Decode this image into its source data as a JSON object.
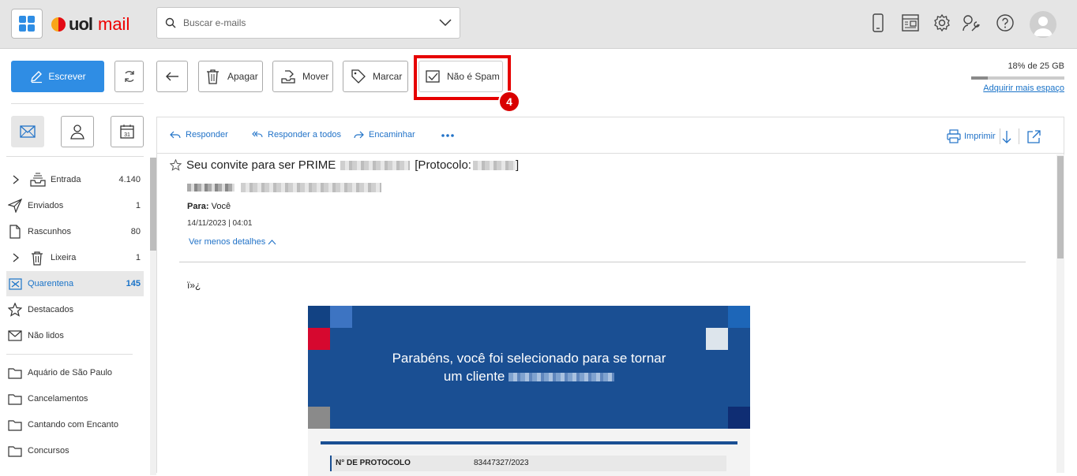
{
  "header": {
    "logo_brand": "uol",
    "logo_product": "mail",
    "search_placeholder": "Buscar e-mails",
    "icons": [
      "mobile-icon",
      "news-icon",
      "settings-icon",
      "tools-icon",
      "help-icon",
      "avatar"
    ]
  },
  "toolbar": {
    "compose_label": "Escrever",
    "delete_label": "Apagar",
    "move_label": "Mover",
    "tag_label": "Marcar",
    "not_spam_label": "Não é Spam",
    "step_badge": "4"
  },
  "quota": {
    "text": "18% de 25 GB",
    "percent": 18,
    "link": "Adquirir mais espaço"
  },
  "sidebar": {
    "folders": [
      {
        "label": "Entrada",
        "count": "4.140"
      },
      {
        "label": "Enviados",
        "count": "1"
      },
      {
        "label": "Rascunhos",
        "count": "80"
      },
      {
        "label": "Lixeira",
        "count": "1"
      },
      {
        "label": "Quarentena",
        "count": "145"
      },
      {
        "label": "Destacados",
        "count": ""
      },
      {
        "label": "Não lidos",
        "count": ""
      }
    ],
    "custom_folders": [
      {
        "label": "Aquário de São Paulo"
      },
      {
        "label": "Cancelamentos"
      },
      {
        "label": "Cantando com Encanto"
      },
      {
        "label": "Concursos"
      }
    ]
  },
  "message": {
    "actions": {
      "reply": "Responder",
      "reply_all": "Responder a todos",
      "forward": "Encaminhar",
      "print": "Imprimir"
    },
    "subject_prefix": "Seu convite para ser PRIME",
    "subject_protocol": "[Protocolo:",
    "subject_end": "]",
    "to_label": "Para:",
    "to_value": "Você",
    "date": "14/11/2023 | 04:01",
    "less_details": "Ver menos detalhes",
    "bom_text": "ï»¿",
    "banner_line1": "Parabéns, você foi selecionado para se tornar",
    "banner_line2": "um cliente",
    "protocol_label": "N° DE PROTOCOLO",
    "protocol_value": "83447327/2023"
  },
  "colors": {
    "accent": "#2f8de4",
    "highlight": "#e60000",
    "banner": "#1a4f93"
  }
}
